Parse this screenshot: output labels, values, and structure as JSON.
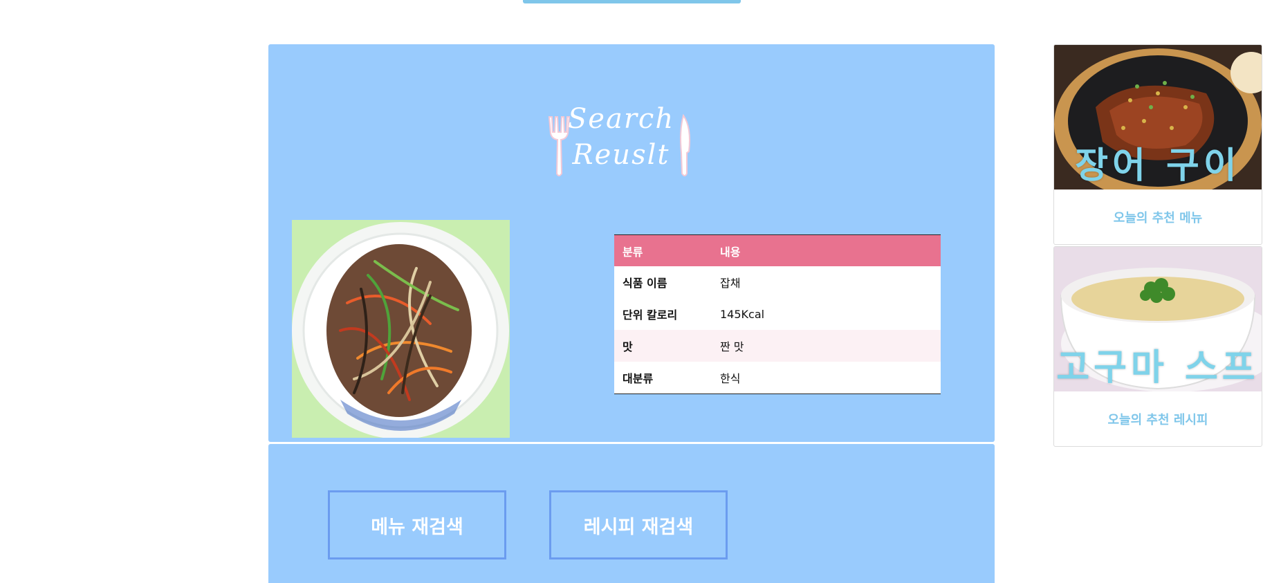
{
  "logo": {
    "line1": "Search",
    "line2": "Reuslt"
  },
  "info_table": {
    "headers": [
      "분류",
      "내용"
    ],
    "rows": [
      {
        "label": "식품 이름",
        "value": "잡채"
      },
      {
        "label": "단위 칼로리",
        "value": "145Kcal"
      },
      {
        "label": "맛",
        "value": "짠 맛"
      },
      {
        "label": "대분류",
        "value": "한식"
      }
    ]
  },
  "actions": {
    "menu_research": "메뉴 재검색",
    "recipe_research": "레시피 재검색"
  },
  "recommendations": [
    {
      "overlay": "장어 구이",
      "caption": "오늘의 추천 메뉴"
    },
    {
      "overlay": "고구마 스프",
      "caption": "오늘의 추천 레시피"
    }
  ],
  "colors": {
    "panel_bg": "#99cbfd",
    "table_header": "#e8728f",
    "button_border": "#6b9cef",
    "accent": "#7fc6ea"
  }
}
